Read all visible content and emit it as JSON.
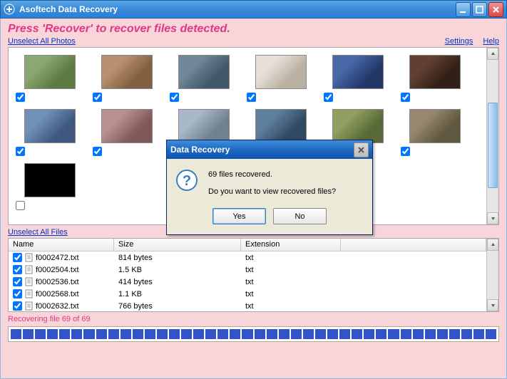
{
  "titlebar": {
    "title": "Asoftech Data Recovery"
  },
  "instruction": "Press 'Recover' to recover files detected.",
  "links": {
    "unselect_photos": "Unselect All Photos",
    "unselect_files": "Unselect All Files",
    "settings": "Settings",
    "help": "Help"
  },
  "photos": [
    {
      "checked": true
    },
    {
      "checked": true
    },
    {
      "checked": true
    },
    {
      "checked": true
    },
    {
      "checked": true
    },
    {
      "checked": true
    },
    {
      "checked": true
    },
    {
      "checked": true
    },
    {
      "checked": true
    },
    {
      "checked": true
    },
    {
      "checked": true
    },
    {
      "checked": true
    },
    {
      "checked": false
    }
  ],
  "file_table": {
    "headers": {
      "name": "Name",
      "size": "Size",
      "extension": "Extension"
    },
    "rows": [
      {
        "name": "f0002472.txt",
        "size": "814 bytes",
        "ext": "txt",
        "checked": true
      },
      {
        "name": "f0002504.txt",
        "size": "1.5 KB",
        "ext": "txt",
        "checked": true
      },
      {
        "name": "f0002536.txt",
        "size": "414 bytes",
        "ext": "txt",
        "checked": true
      },
      {
        "name": "f0002568.txt",
        "size": "1.1 KB",
        "ext": "txt",
        "checked": true
      },
      {
        "name": "f0002632.txt",
        "size": "766 bytes",
        "ext": "txt",
        "checked": true
      }
    ]
  },
  "status": "Recovering file 69 of 69",
  "dialog": {
    "title": "Data Recovery",
    "line1": "69 files recovered.",
    "line2": "Do you want to view recovered files?",
    "yes": "Yes",
    "no": "No"
  }
}
